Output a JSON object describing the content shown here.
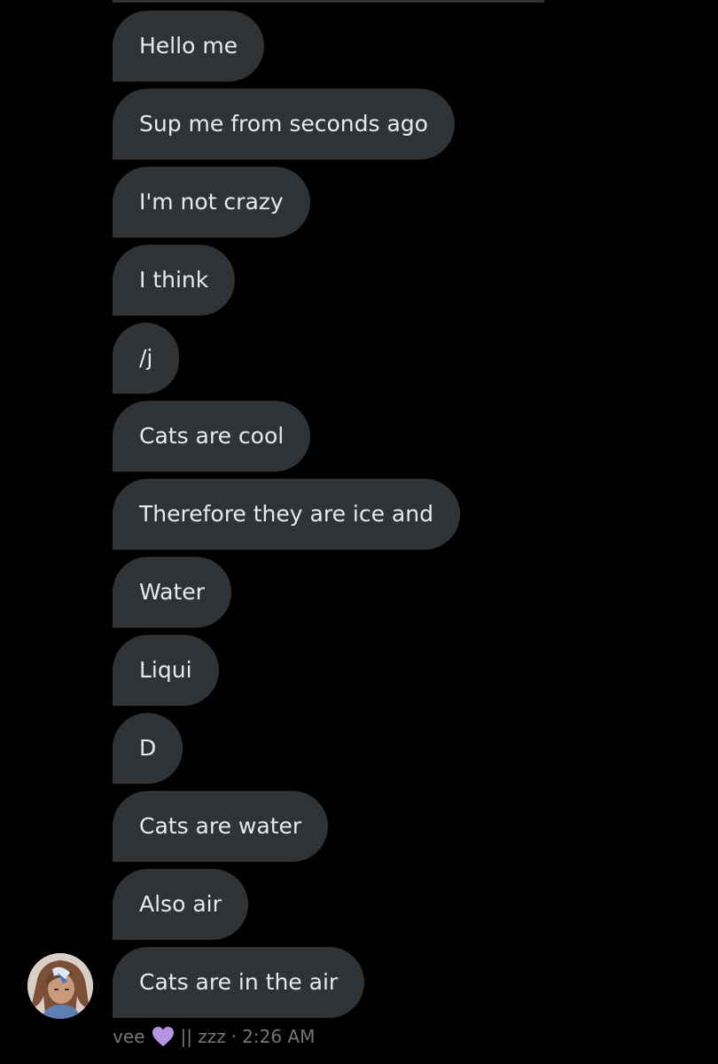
{
  "messages": [
    "Hello me",
    "Sup me from seconds ago",
    "I'm not crazy",
    "I think",
    "/j",
    "Cats are cool",
    "Therefore they are ice and",
    "Water",
    "Liqui",
    "D",
    "Cats are water",
    "Also air",
    "Cats are in the air"
  ],
  "sender": {
    "name": "vee",
    "name_suffix": "|| zzz",
    "emoji_icon": "purple-heart-icon",
    "avatar_icon": "avatar-image",
    "separator": "·",
    "time": "2:26 AM"
  },
  "colors": {
    "background": "#000000",
    "bubble": "#2f3336",
    "bubble_text": "#e7e9ea",
    "meta_text": "#71767b",
    "heart": "#b794e6"
  }
}
